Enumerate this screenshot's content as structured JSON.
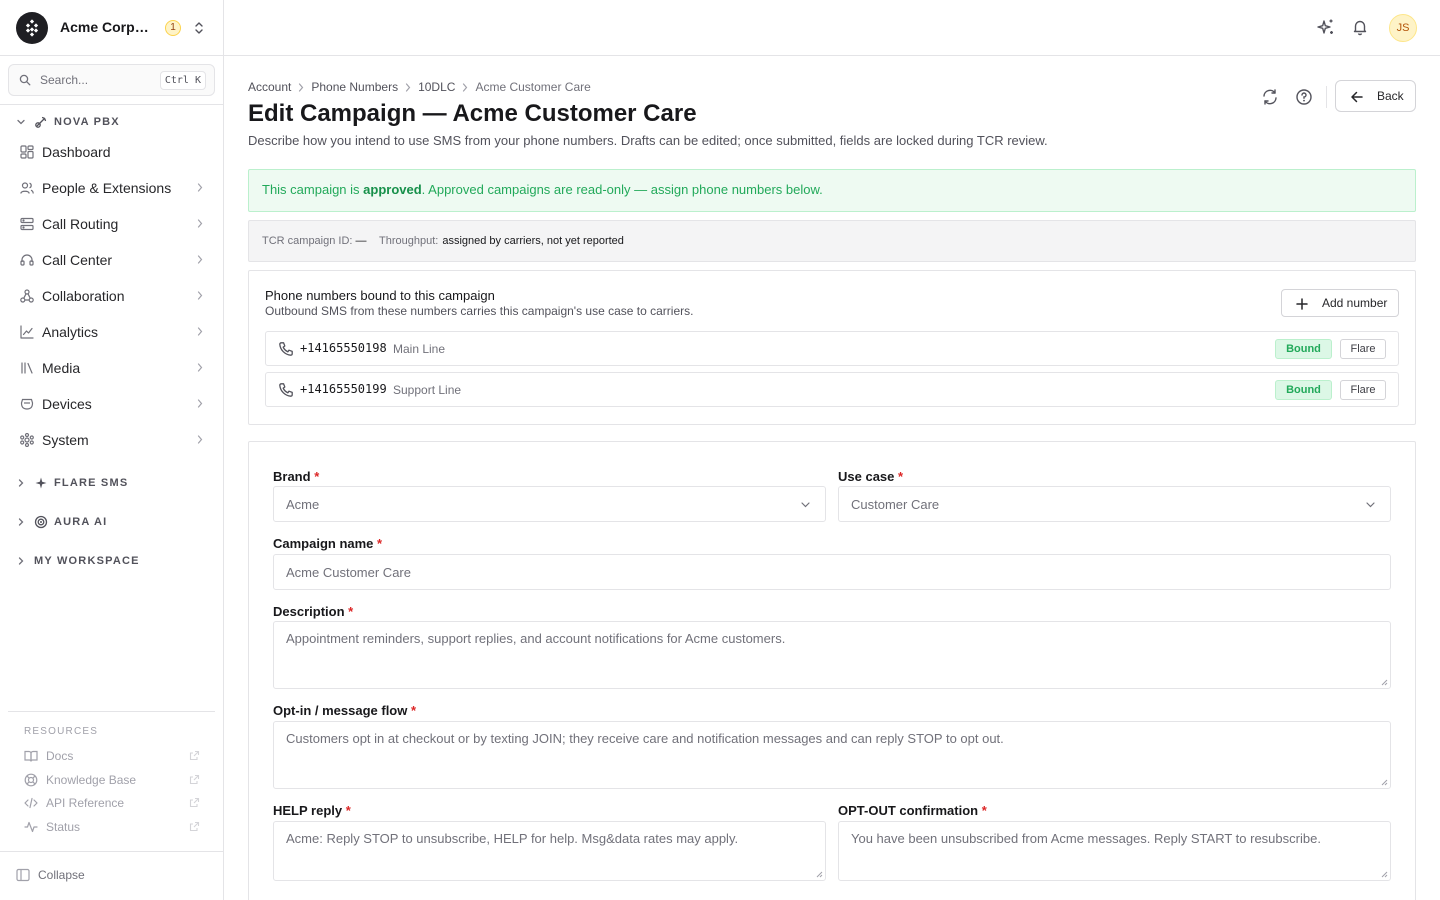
{
  "sidebar": {
    "org_name": "Acme Corporation",
    "org_badge": "1",
    "search": {
      "placeholder": "Search...",
      "shortcut": "Ctrl K"
    },
    "sections": [
      {
        "label": "NOVA PBX",
        "expanded": true
      },
      {
        "label": "FLARE SMS",
        "expanded": false
      },
      {
        "label": "AURA AI",
        "expanded": false
      },
      {
        "label": "MY WORKSPACE",
        "expanded": false
      }
    ],
    "nav": [
      {
        "label": "Dashboard",
        "icon": "dashboard-icon"
      },
      {
        "label": "People & Extensions",
        "icon": "users-icon"
      },
      {
        "label": "Call Routing",
        "icon": "routing-icon"
      },
      {
        "label": "Call Center",
        "icon": "headset-icon"
      },
      {
        "label": "Collaboration",
        "icon": "collaboration-icon"
      },
      {
        "label": "Analytics",
        "icon": "analytics-icon"
      },
      {
        "label": "Media",
        "icon": "media-icon"
      },
      {
        "label": "Devices",
        "icon": "devices-icon"
      },
      {
        "label": "System",
        "icon": "system-icon"
      }
    ],
    "resources_title": "RESOURCES",
    "resources": [
      {
        "label": "Docs",
        "icon": "book-icon"
      },
      {
        "label": "Knowledge Base",
        "icon": "lifebuoy-icon"
      },
      {
        "label": "API Reference",
        "icon": "code-icon"
      },
      {
        "label": "Status",
        "icon": "activity-icon"
      }
    ],
    "collapse_label": "Collapse"
  },
  "topbar": {
    "avatar_initials": "JS"
  },
  "header": {
    "breadcrumbs": [
      "Account",
      "Phone Numbers",
      "10DLC",
      "Acme Customer Care"
    ],
    "title": "Edit Campaign — Acme Customer Care",
    "subtitle": "Describe how you intend to use SMS from your phone numbers. Drafts can be edited; once submitted, fields are locked during TCR review.",
    "back_label": "Back"
  },
  "alert": {
    "prefix": "This campaign is ",
    "status": "approved",
    "suffix": ". Approved campaigns are read-only — assign phone numbers below."
  },
  "meta": {
    "tcr_label": "TCR campaign ID:",
    "tcr_value": "—",
    "throughput_label": "Throughput:",
    "throughput_value": "assigned by carriers, not yet reported"
  },
  "numbers": {
    "title": "Phone numbers bound to this campaign",
    "subtitle": "Outbound SMS from these numbers carries this campaign's use case to carriers.",
    "add_label": "Add number",
    "rows": [
      {
        "number": "+14165550198",
        "label": "Main Line",
        "status": "Bound",
        "provider": "Flare"
      },
      {
        "number": "+14165550199",
        "label": "Support Line",
        "status": "Bound",
        "provider": "Flare"
      }
    ]
  },
  "form": {
    "required_mark": "*",
    "brand": {
      "label": "Brand",
      "value": "Acme"
    },
    "use_case": {
      "label": "Use case",
      "value": "Customer Care"
    },
    "campaign_name": {
      "label": "Campaign name",
      "value": "Acme Customer Care"
    },
    "description": {
      "label": "Description",
      "value": "Appointment reminders, support replies, and account notifications for Acme customers."
    },
    "opt_in": {
      "label": "Opt-in / message flow",
      "value": "Customers opt in at checkout or by texting JOIN; they receive care and notification messages and can reply STOP to opt out."
    },
    "help_reply": {
      "label": "HELP reply",
      "value": "Acme: Reply STOP to unsubscribe, HELP for help. Msg&data rates may apply."
    },
    "opt_out": {
      "label": "OPT-OUT confirmation",
      "value": "You have been unsubscribed from Acme messages. Reply START to resubscribe."
    }
  }
}
